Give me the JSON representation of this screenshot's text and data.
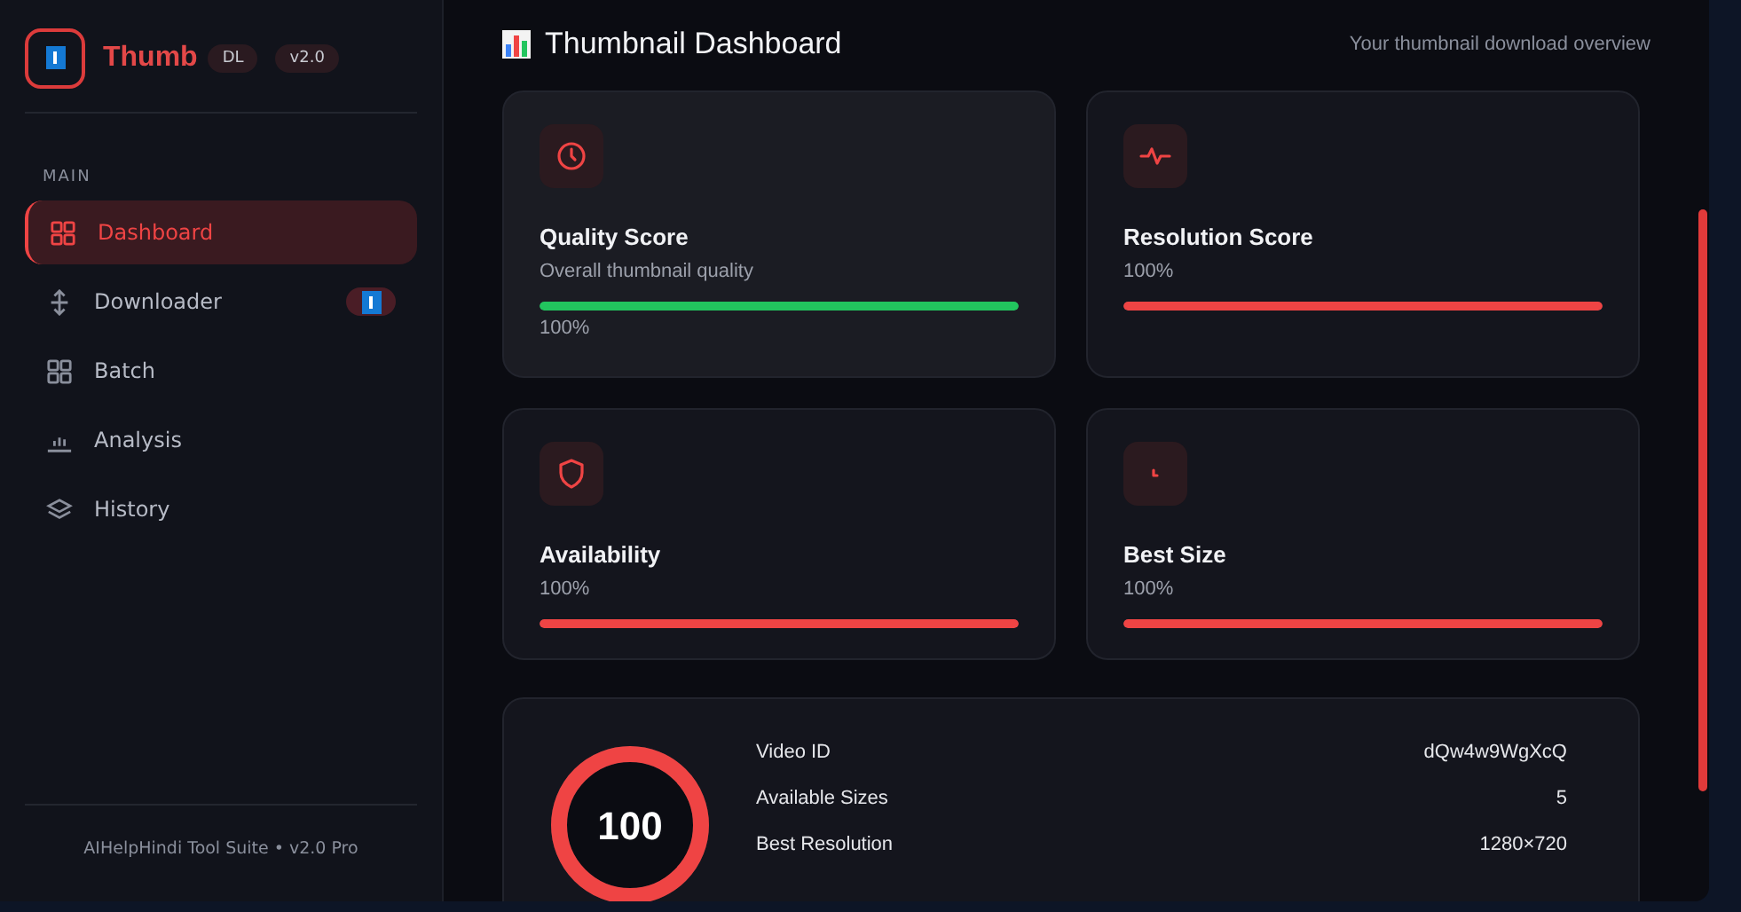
{
  "brand": {
    "name": "Thumb",
    "tag": "DL",
    "version": "v2.0"
  },
  "sidebar": {
    "section": "MAIN",
    "items": [
      {
        "label": "Dashboard",
        "selected": true,
        "badge": false
      },
      {
        "label": "Downloader",
        "selected": false,
        "badge": true
      },
      {
        "label": "Batch",
        "selected": false,
        "badge": false
      },
      {
        "label": "Analysis",
        "selected": false,
        "badge": false
      },
      {
        "label": "History",
        "selected": false,
        "badge": false
      }
    ],
    "footer": "AIHelpHindi Tool Suite • v2.0 Pro"
  },
  "header": {
    "title": "Thumbnail Dashboard",
    "subtitle": "Your thumbnail download overview"
  },
  "cards": [
    {
      "kind": "detailed",
      "title": "Quality Score",
      "subtitle": "Overall thumbnail quality",
      "reading": "100%",
      "level": 1,
      "color": "#22c55e"
    },
    {
      "kind": "simple",
      "title": "Resolution Score",
      "reading": "100%",
      "level": 1,
      "color": "#ef4444"
    },
    {
      "kind": "simple",
      "title": "Availability",
      "reading": "100%",
      "level": 1,
      "color": "#ef4444"
    },
    {
      "kind": "simple",
      "title": "Best Size",
      "reading": "100%",
      "level": 1,
      "color": "#ef4444"
    }
  ],
  "summary": {
    "score": "100",
    "rows": [
      {
        "label": "Video ID",
        "value": "dQw4w9WgXcQ"
      },
      {
        "label": "Available Sizes",
        "value": "5"
      },
      {
        "label": "Best Resolution",
        "value": "1280×720"
      }
    ]
  }
}
